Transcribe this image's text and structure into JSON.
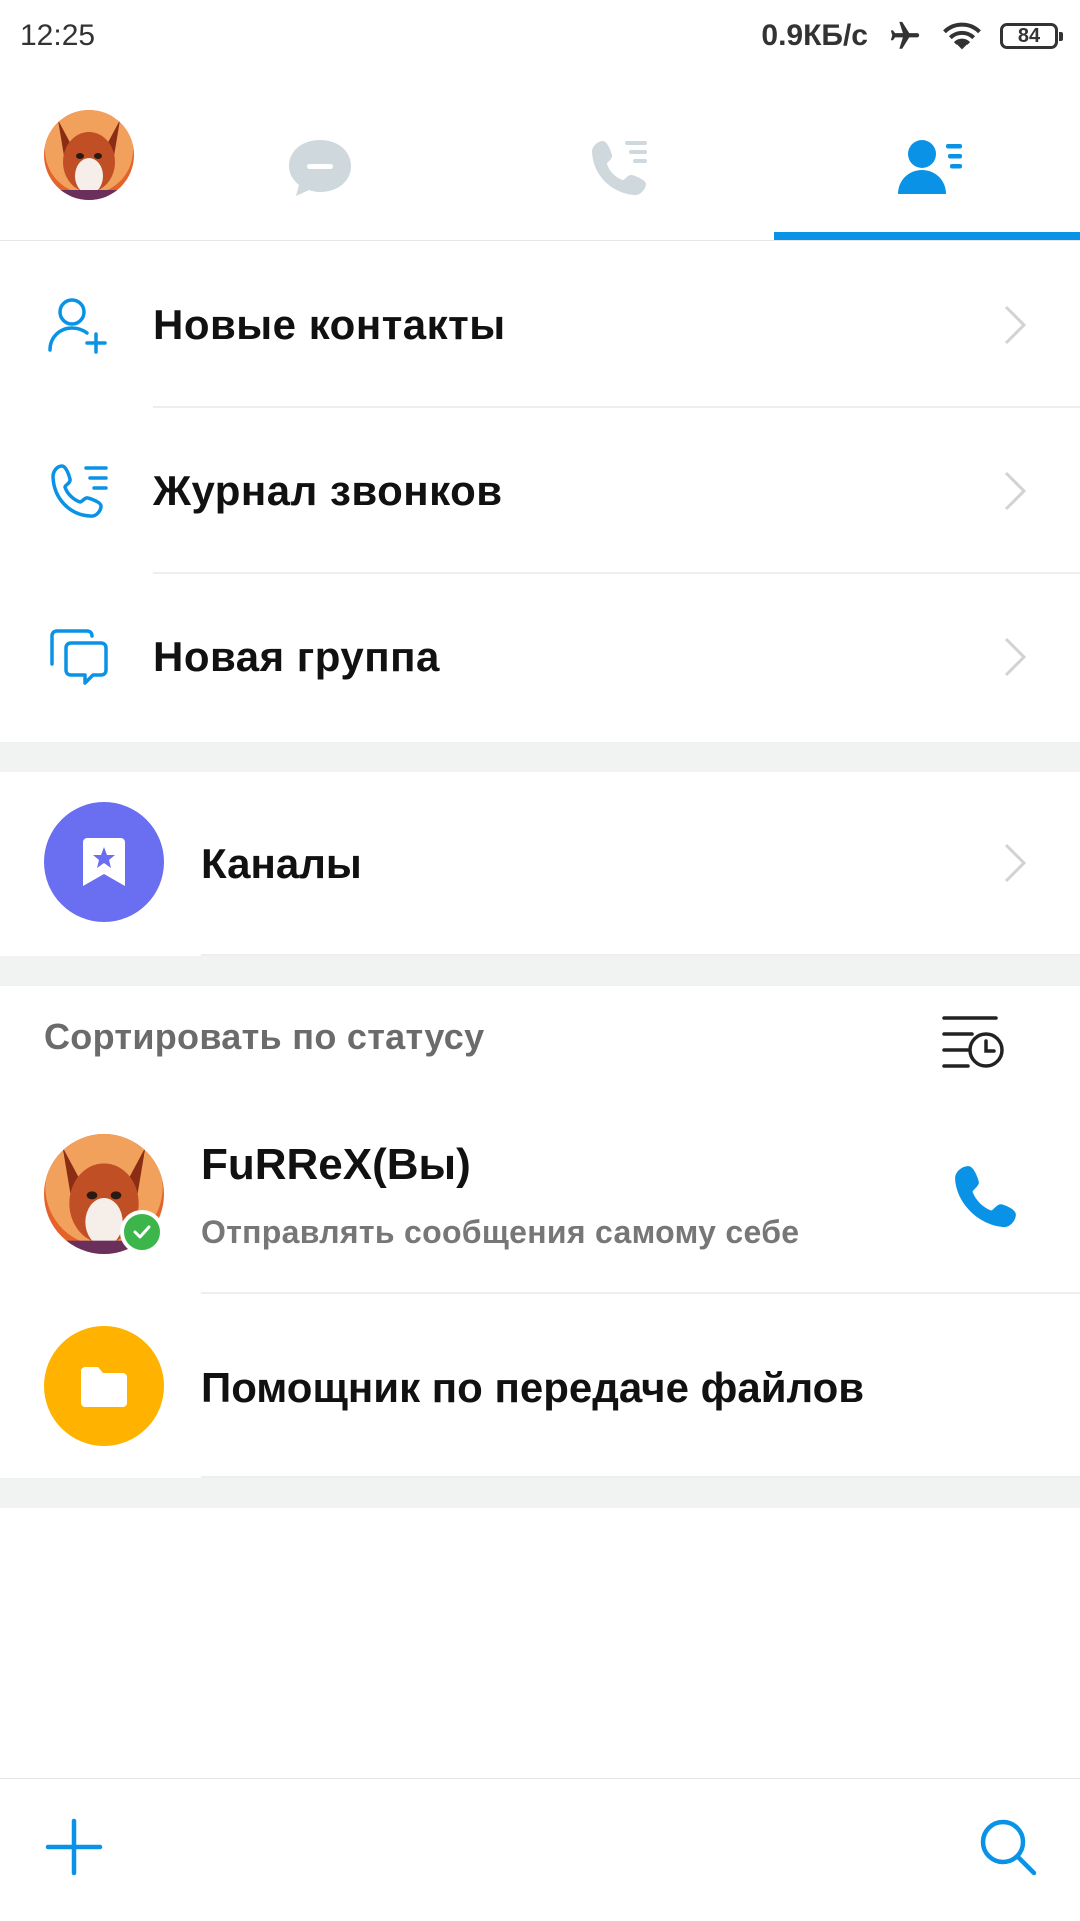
{
  "status_bar": {
    "time": "12:25",
    "network_speed": "0.9КБ/с",
    "battery": "84"
  },
  "top_nav": {
    "tabs": [
      {
        "name": "chats",
        "icon": "chat-bubble-icon",
        "active": false
      },
      {
        "name": "calls",
        "icon": "call-log-icon",
        "active": false
      },
      {
        "name": "contacts",
        "icon": "contacts-icon",
        "active": true
      }
    ],
    "accent_color": "#0a93e6"
  },
  "menu": {
    "items": [
      {
        "label": "Новые контакты",
        "icon": "add-contact-icon"
      },
      {
        "label": "Журнал звонков",
        "icon": "call-log-icon"
      },
      {
        "label": "Новая группа",
        "icon": "new-group-icon"
      }
    ]
  },
  "channels": {
    "label": "Каналы",
    "icon": "bookmark-star-icon",
    "color": "#6a6ef0"
  },
  "contacts": {
    "sort_label": "Сортировать по статусу",
    "sort_icon": "sort-clock-icon",
    "items": [
      {
        "name": "FuRReX(Вы)",
        "subtitle": "Отправлять сообщения самому себе",
        "online": true
      },
      {
        "name": "Помощник по передаче файлов",
        "icon": "folder-icon",
        "color": "#ffb300"
      }
    ]
  },
  "bottom_bar": {
    "left_icon": "plus-icon",
    "right_icon": "search-icon"
  }
}
